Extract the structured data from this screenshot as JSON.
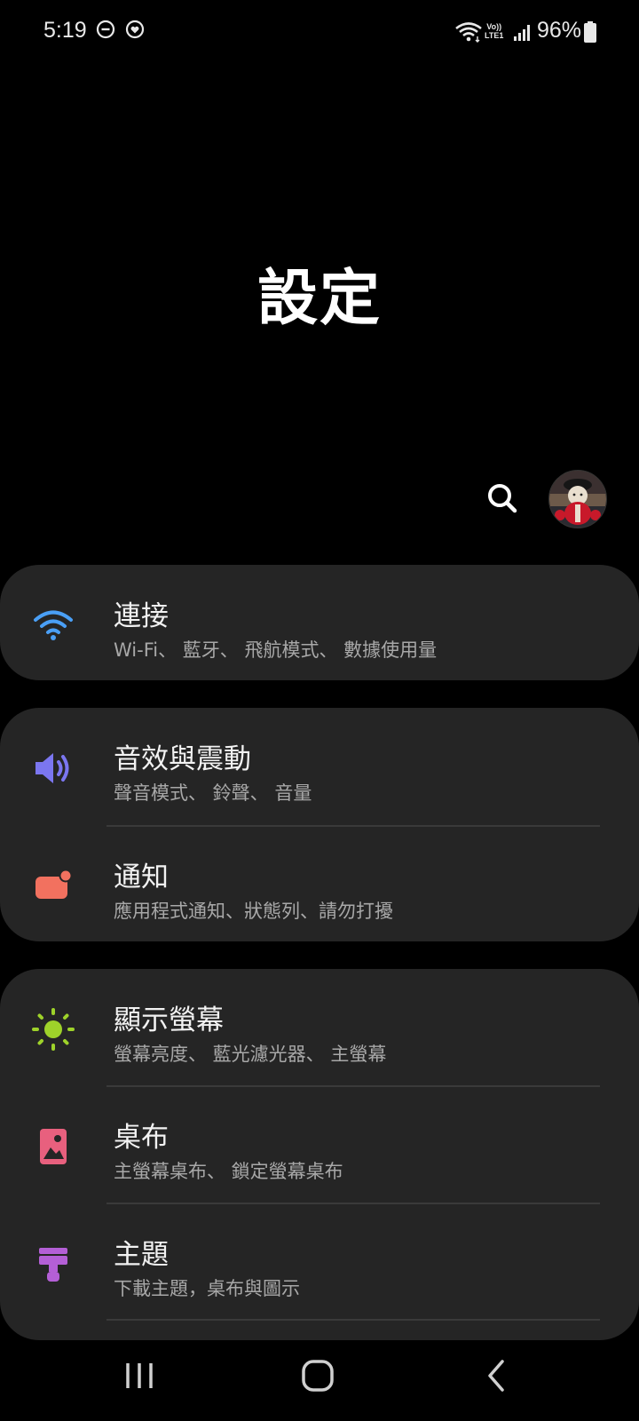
{
  "status_bar": {
    "time": "5:19",
    "icons": [
      "do-not-disturb-icon",
      "heart-sync-icon",
      "wifi-icon",
      "volte-icon",
      "signal-icon",
      "battery-icon"
    ],
    "volte_top": "Vo))",
    "volte_bottom": "LTE1",
    "battery_percent": "96%"
  },
  "header": {
    "title": "設定"
  },
  "colors": {
    "background": "#000000",
    "card": "#252525",
    "connections_icon": "#4a9ff5",
    "sound_icon": "#7b76f0",
    "notifications_icon": "#f2715f",
    "display_icon": "#9ed22a",
    "wallpaper_icon": "#e8607e",
    "themes_icon": "#b45fd6"
  },
  "settings": {
    "connections": {
      "title": "連接",
      "subtitle": "Wi-Fi、 藍牙、 飛航模式、 數據使用量",
      "icon": "wifi-icon"
    },
    "sound": {
      "title": "音效與震動",
      "subtitle": "聲音模式、 鈴聲、 音量",
      "icon": "speaker-icon"
    },
    "notifications": {
      "title": "通知",
      "subtitle": "應用程式通知、狀態列、請勿打擾",
      "icon": "notification-icon"
    },
    "display": {
      "title": "顯示螢幕",
      "subtitle": "螢幕亮度、 藍光濾光器、 主螢幕",
      "icon": "sun-icon"
    },
    "wallpaper": {
      "title": "桌布",
      "subtitle": "主螢幕桌布、 鎖定螢幕桌布",
      "icon": "image-icon"
    },
    "themes": {
      "title": "主題",
      "subtitle": "下載主題，桌布與圖示",
      "icon": "paint-brush-icon"
    }
  },
  "nav_bar": {
    "buttons": [
      "recents-icon",
      "home-icon",
      "back-icon"
    ]
  }
}
